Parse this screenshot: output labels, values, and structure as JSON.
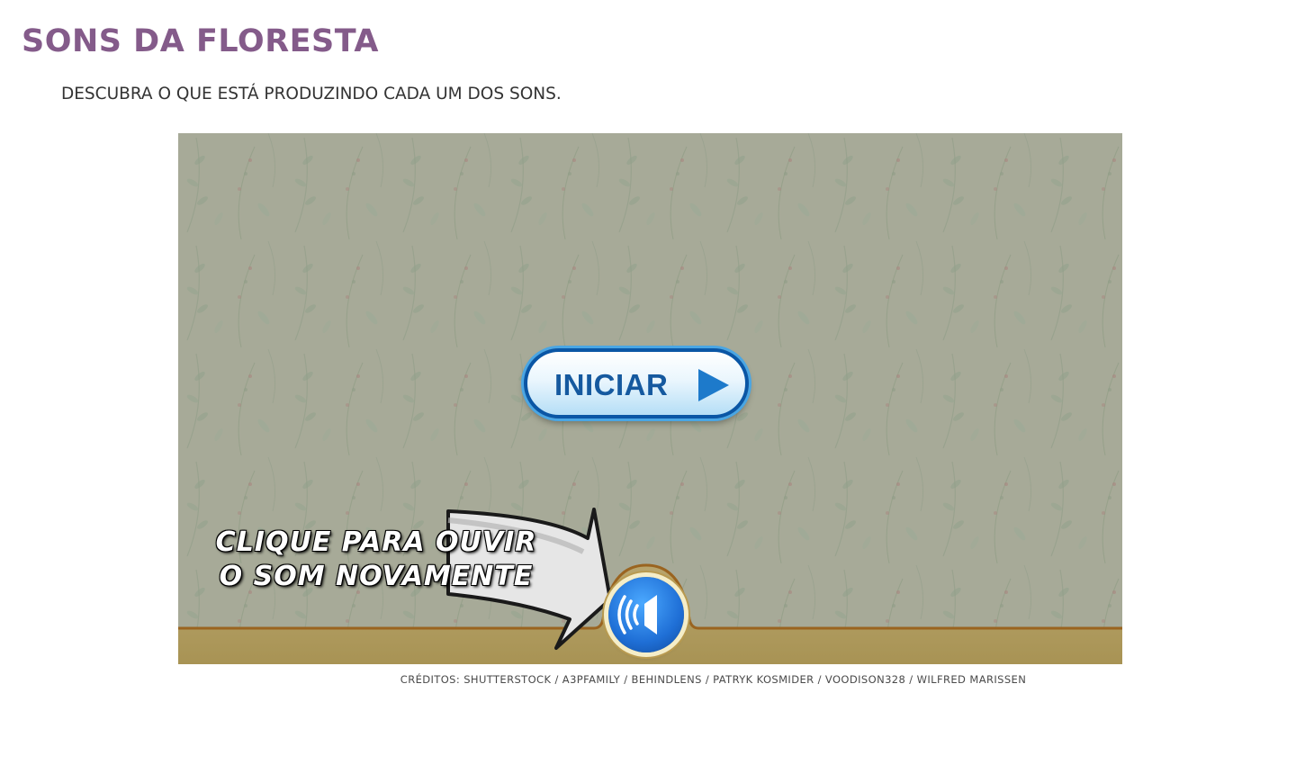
{
  "page": {
    "title": "SONS DA FLORESTA",
    "subtitle": "DESCUBRA O QUE ESTÁ PRODUZINDO CADA UM DOS SONS."
  },
  "game": {
    "start_button_label": "INICIAR",
    "start_button_icon": "play-icon",
    "hint_line1": "CLIQUE PARA OUVIR",
    "hint_line2": "O SOM NOVAMENTE",
    "replay_button_icon": "speaker-icon",
    "credits": "CRÉDITOS: SHUTTERSTOCK / A3PFAMILY / BEHINDLENS / PATRYK KOSMIDER / VOODISON328 / WILFRED MARISSEN"
  },
  "colors": {
    "title": "#845b8a",
    "background_pattern": "#a7aa98",
    "bottom_bar": "#ad9a62",
    "button_blue": "#15599f",
    "replay_blue": "#1f6fd6"
  }
}
